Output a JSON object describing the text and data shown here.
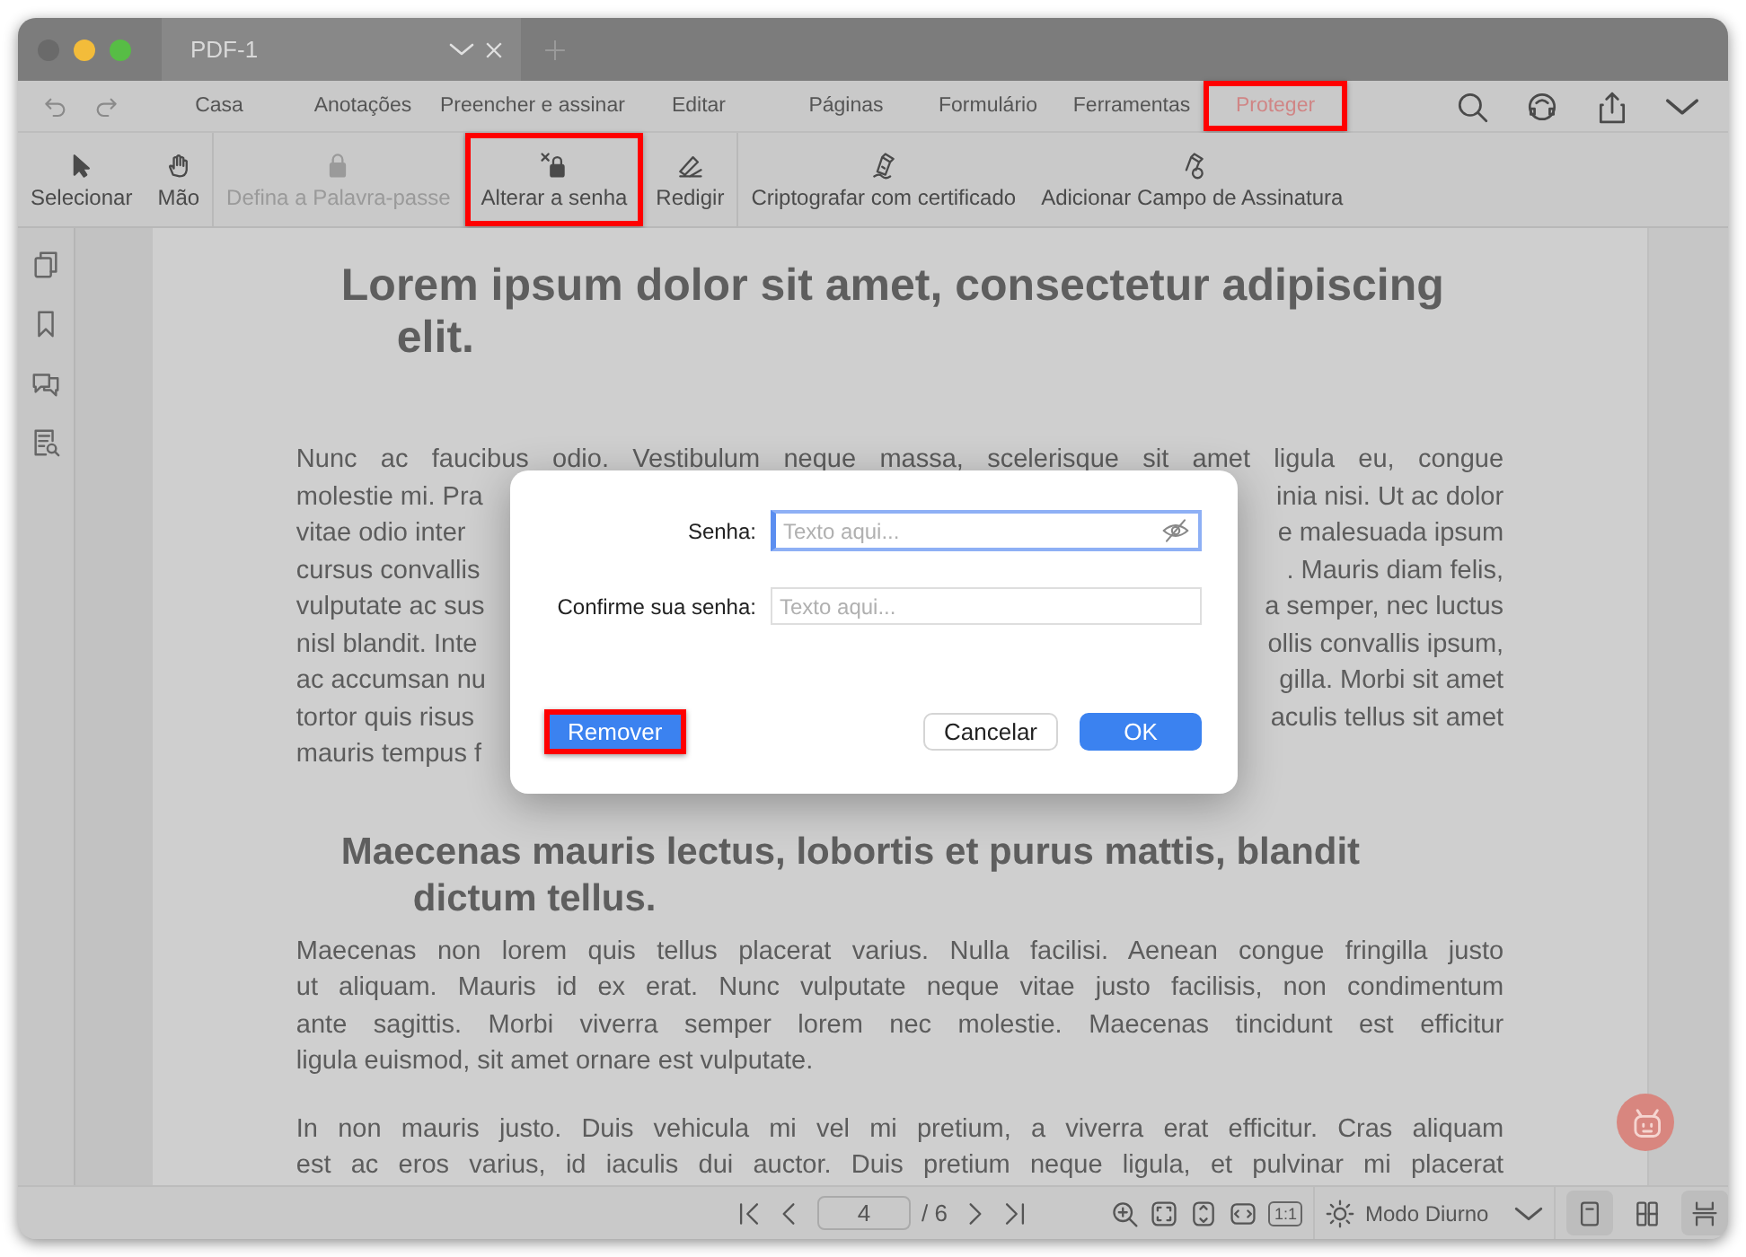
{
  "window": {
    "tabs": [
      {
        "label": "PDF-1",
        "selected": true
      }
    ]
  },
  "menu": {
    "tabs": [
      {
        "label": "Casa",
        "selected": false,
        "highlighted": false
      },
      {
        "label": "Anotações",
        "selected": false,
        "highlighted": false
      },
      {
        "label": "Preencher e assinar",
        "selected": false,
        "highlighted": false
      },
      {
        "label": "Editar",
        "selected": false,
        "highlighted": false
      },
      {
        "label": "Páginas",
        "selected": false,
        "highlighted": false
      },
      {
        "label": "Formulário",
        "selected": false,
        "highlighted": false
      },
      {
        "label": "Ferramentas",
        "selected": false,
        "highlighted": false
      },
      {
        "label": "Proteger",
        "selected": true,
        "highlighted": true
      }
    ]
  },
  "toolbar": [
    {
      "kind": "pointer",
      "label": "Selecionar",
      "disabled": false,
      "highlighted": false
    },
    {
      "kind": "hand",
      "label": "Mão",
      "disabled": false,
      "highlighted": false
    },
    {
      "kind": "lock",
      "label": "Defina a Palavra-passe",
      "disabled": true,
      "highlighted": false
    },
    {
      "kind": "unlock",
      "label": "Alterar a senha",
      "disabled": false,
      "highlighted": true
    },
    {
      "kind": "redact",
      "label": "Redigir",
      "disabled": false,
      "highlighted": false
    },
    {
      "kind": "pen",
      "label": "Criptografar com certificado",
      "disabled": false,
      "highlighted": false
    },
    {
      "kind": "seal",
      "label": "Adicionar Campo de Assinatura",
      "disabled": false,
      "highlighted": false
    }
  ],
  "document": {
    "heading_1": "Lorem ipsum dolor sit amet, consectetur adipiscing elit.",
    "paragraph_1": [
      {
        "left": "Nunc ac faucibus odio. Vestibulum neque massa, scelerisque sit amet ligula eu, congue"
      },
      {
        "left": "molestie mi. Pra",
        "right": "inia nisi. Ut ac dolor"
      },
      {
        "left": "vitae odio inter",
        "right": "e malesuada ipsum"
      },
      {
        "left": "cursus convallis",
        "right": ". Mauris diam felis,"
      },
      {
        "left": "vulputate ac sus",
        "right": "a semper, nec luctus"
      },
      {
        "left": "nisl blandit. Inte",
        "right": "ollis convallis ipsum,"
      },
      {
        "left": "ac accumsan nu",
        "right": "gilla. Morbi sit amet"
      },
      {
        "left": "tortor quis risus",
        "right": "aculis tellus sit amet"
      },
      {
        "left": "mauris tempus f"
      }
    ],
    "heading_2": "Maecenas mauris lectus, lobortis et purus mattis, blandit dictum tellus.",
    "paragraph_2": [
      "Maecenas non lorem quis tellus placerat varius. Nulla facilisi. Aenean congue fringilla justo",
      "ut aliquam. Mauris id ex erat. Nunc vulputate neque vitae justo facilisis, non condimentum",
      "ante sagittis. Morbi viverra semper lorem nec molestie. Maecenas tincidunt est efficitur",
      "ligula euismod, sit amet ornare est vulputate."
    ],
    "paragraph_3": [
      "In non mauris justo. Duis vehicula mi vel mi pretium, a viverra erat efficitur. Cras aliquam",
      "est ac eros varius, id iaculis dui auctor. Duis pretium neque ligula, et pulvinar mi placerat"
    ]
  },
  "dialog": {
    "fields": [
      {
        "label": "Senha:",
        "placeholder": "Texto aqui...",
        "focused": true
      },
      {
        "label": "Confirme sua senha:",
        "placeholder": "Texto aqui...",
        "focused": false
      }
    ],
    "buttons": [
      {
        "label": "Remover",
        "kind": "primary",
        "highlighted": true
      },
      {
        "label": "Cancelar",
        "kind": "secondary",
        "highlighted": false
      },
      {
        "label": "OK",
        "kind": "primary",
        "highlighted": false
      }
    ]
  },
  "status_bar": {
    "page": "4",
    "total": "/ 6",
    "zoom_label": "1:1",
    "mode": "Modo Diurno",
    "views": [
      {
        "kind": "single",
        "selected": true
      },
      {
        "kind": "double",
        "selected": false
      },
      {
        "kind": "scroll",
        "selected": true
      }
    ]
  }
}
